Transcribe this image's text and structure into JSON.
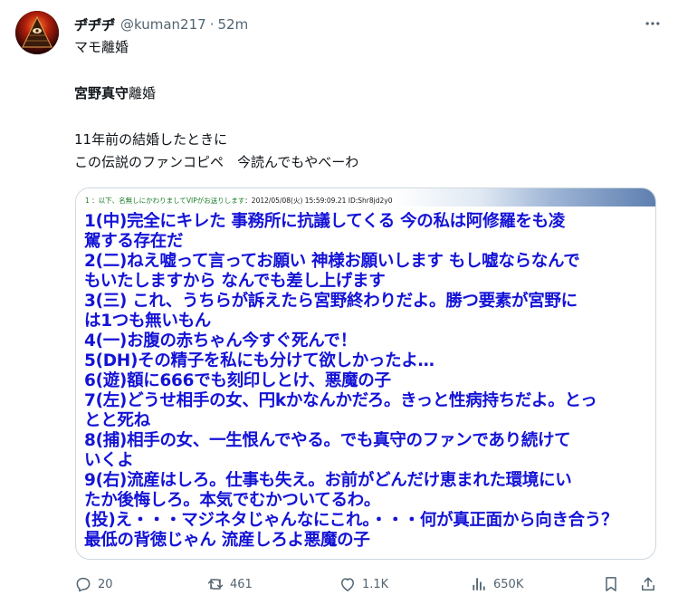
{
  "tweet": {
    "display_name": "ヂ゙ヂ゙ヂ゙",
    "handle": "@kuman217",
    "separator": "·",
    "time": "52m",
    "lines": [
      "マモ離婚",
      "宮野真守離婚",
      "11年前の結婚したときに",
      "この伝説のファンコピペ　今読んでもやべーわ"
    ],
    "line2_bold": "宮野真守",
    "line2_rest": "離婚"
  },
  "media": {
    "header_title": "1 ：以下、名無しにかわりましてVIPがお送りします",
    "header_meta": "：2012/05/08(火) 15:59:09.21 ID:Shr8jd2y0",
    "body_lines": [
      "1(中)完全にキレた 事務所に抗議してくる 今の私は阿修羅をも凌",
      "駕する存在だ",
      "2(二)ねえ嘘って言ってお願い 神様お願いします もし嘘ならなんで",
      "もいたしますから なんでも差し上げます",
      "3(三) これ、うちらが訴えたら宮野終わりだよ。勝つ要素が宮野に",
      "は1つも無いもん",
      "4(一)お腹の赤ちゃん今すぐ死んで！",
      "5(DH)その精子を私にも分けて欲しかったよ…",
      "6(遊)額に666でも刻印しとけ、悪魔の子",
      "7(左)どうせ相手の女、円kかなんかだろ。きっと性病持ちだよ。とっ",
      "とと死ね",
      "8(捕)相手の女、一生恨んでやる。でも真守のファンであり続けて",
      "いくよ",
      "9(右)流産はしろ。仕事も失え。お前がどんだけ恵まれた環境にい",
      "たか後悔しろ。本気でむかついてるわ。",
      "(投)え・・・マジネタじゃんなにこれ。・・・何が真正面から向き合う？",
      "最低の背徳じゃん 流産しろよ悪魔の子"
    ]
  },
  "actions": {
    "replies": "20",
    "reposts": "461",
    "likes": "1.1K",
    "views": "650K"
  },
  "icons": {
    "more": "more-icon",
    "reply": "reply-icon",
    "repost": "repost-icon",
    "like": "like-icon",
    "views": "views-icon",
    "bookmark": "bookmark-icon",
    "share": "share-icon"
  },
  "colors": {
    "text": "#0f1419",
    "secondary": "#536471",
    "media_text": "#1413d6",
    "media_header": "#1a7d27",
    "border": "#cfd9de"
  }
}
